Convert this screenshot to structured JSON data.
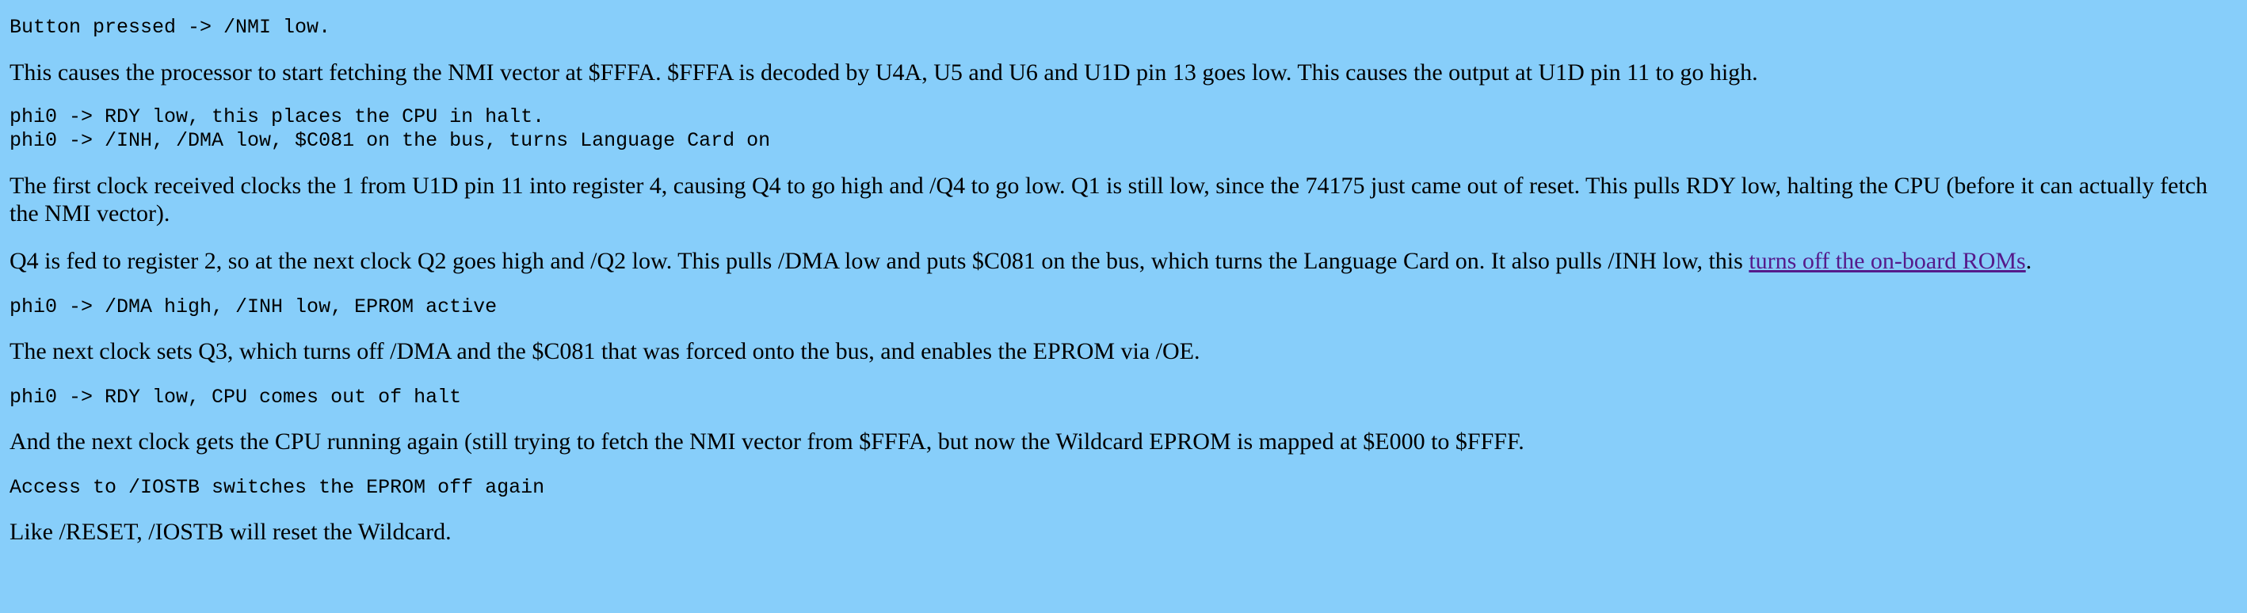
{
  "blocks": {
    "code1": [
      "Button pressed -> /NMI low."
    ],
    "para1": "This causes the processor to start fetching the NMI vector at $FFFA. $FFFA is decoded by U4A, U5 and U6 and U1D pin 13 goes low. This causes the output at U1D pin 11 to go high.",
    "code2": [
      "phi0 -> RDY low, this places the CPU in halt.",
      "phi0 -> /INH, /DMA low, $C081 on the bus, turns Language Card on"
    ],
    "para2": "The first clock received clocks the 1 from U1D pin 11 into register 4, causing Q4 to go high and /Q4 to go low. Q1 is still low, since the 74175 just came out of reset. This pulls RDY low, halting the CPU (before it can actually fetch the NMI vector).",
    "para3_before": "Q4 is fed to register 2, so at the next clock Q2 goes high and /Q2 low. This pulls /DMA low and puts $C081 on the bus, which turns the Language Card on. It also pulls /INH low, this ",
    "para3_link": "turns off the on-board ROMs",
    "para3_after": ".",
    "code3": [
      "phi0 -> /DMA high, /INH low, EPROM active"
    ],
    "para4": "The next clock sets Q3, which turns off /DMA and the $C081 that was forced onto the bus, and enables the EPROM via /OE.",
    "code4": [
      "phi0 -> RDY low, CPU comes out of halt"
    ],
    "para5": "And the next clock gets the CPU running again (still trying to fetch the NMI vector from $FFFA, but now the Wildcard EPROM is mapped at $E000 to $FFFF.",
    "code5": [
      "Access to /IOSTB switches the EPROM off again"
    ],
    "para6": "Like /RESET, /IOSTB will reset the Wildcard."
  },
  "colors": {
    "background": "#87cefa",
    "text": "#000000",
    "link": "#551a8b"
  }
}
